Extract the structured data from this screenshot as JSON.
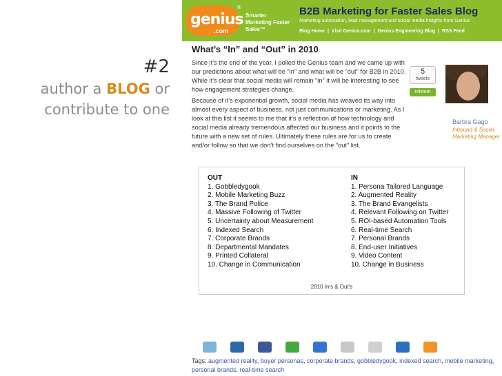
{
  "slide": {
    "number": "#2",
    "line1_pre": "author a ",
    "line1_highlight": "BLOG",
    "line1_post": " or",
    "line2": "contribute to one"
  },
  "blog": {
    "logo_text": "genius",
    "logo_suffix": ".com",
    "logo_reg": "®",
    "tagline": "Smarter Marketing Faster Sales™",
    "title": "B2B Marketing for Faster Sales Blog",
    "subtitle": "Marketing automation, lead management and social media insights from Genius",
    "nav": [
      "Blog Home",
      "Visit Genius.com",
      "Genius Engineering Blog",
      "RSS Feed"
    ],
    "nav_sep": "|",
    "colors": {
      "banner": "#8cbd2c",
      "logo": "#f08a1d",
      "link": "#3a55a4",
      "accent": "#d98a1e"
    }
  },
  "post": {
    "title": "What’s “In” and “Out” in 2010",
    "paragraph1": "Since it’s the end of the year, I polled the Genius team and we came up with our predictions about what will be \"in\" and what will be \"out\" for B2B in 2010. While it’s clear that social media will remain \"in\" it will be interesting to see how engagement strategies change.",
    "paragraph2": "Because of it’s exponential growth, social media has weaved its way into almost every aspect of business, not just communications or marketing. As I look at this list it seems to me that it’s a reflection of how technology and social media already tremendous affected our business and it points to the future with a new set of rules. Ultimately these rules are for us to create and/or follow so that we don’t find ourselves on the \"out\" list.",
    "tweet_count": "5",
    "tweet_label": "tweets",
    "retweet_label": "retweet",
    "author_name": "Barbra Gago",
    "author_role": "Inbound & Social Marketing Manager"
  },
  "table": {
    "out_header": "OUT",
    "in_header": "IN",
    "out_items": [
      "1. Gobbledygook",
      "2. Mobile Marketing Buzz",
      "3. The Brand Police",
      "4. Massive Following of Twitter",
      "5. Uncertainty about Measurement",
      "6. Indexed Search",
      "7. Corporate Brands",
      "8. Departmental Mandates",
      "9. Printed Collateral",
      "10. Change in Communication"
    ],
    "in_items": [
      "1. Persona Tailored Language",
      "2. Augmented Reality",
      "3. The Brand Evangelists",
      "4. Relevant Following on Twitter",
      "5. ROI-based Automation Tools",
      "6. Real-time Search",
      "7. Personal Brands",
      "8. End-user Initiatives",
      "9. Video Content",
      "10. Change in Business"
    ],
    "caption": "2010 In's & Out's"
  },
  "share_icons": [
    {
      "name": "twitter-icon",
      "color": "#7fb3d9"
    },
    {
      "name": "linkedin-icon",
      "color": "#2b6aa8"
    },
    {
      "name": "facebook-icon",
      "color": "#3b5998"
    },
    {
      "name": "stumbleupon-icon",
      "color": "#46a843"
    },
    {
      "name": "delicious-icon",
      "color": "#3274d1"
    },
    {
      "name": "digg-icon",
      "color": "#c8c8c8"
    },
    {
      "name": "reddit-icon",
      "color": "#d0d0d0"
    },
    {
      "name": "email-icon",
      "color": "#2d6fc0"
    },
    {
      "name": "rss-icon",
      "color": "#f0932b"
    }
  ],
  "tags": {
    "label": "Tags: ",
    "items": [
      "augmented reality",
      "buyer personas",
      "corporate brands",
      "gobbledygook",
      "indexed search",
      "mobile marketing",
      "personal brands",
      "real-time search"
    ]
  }
}
